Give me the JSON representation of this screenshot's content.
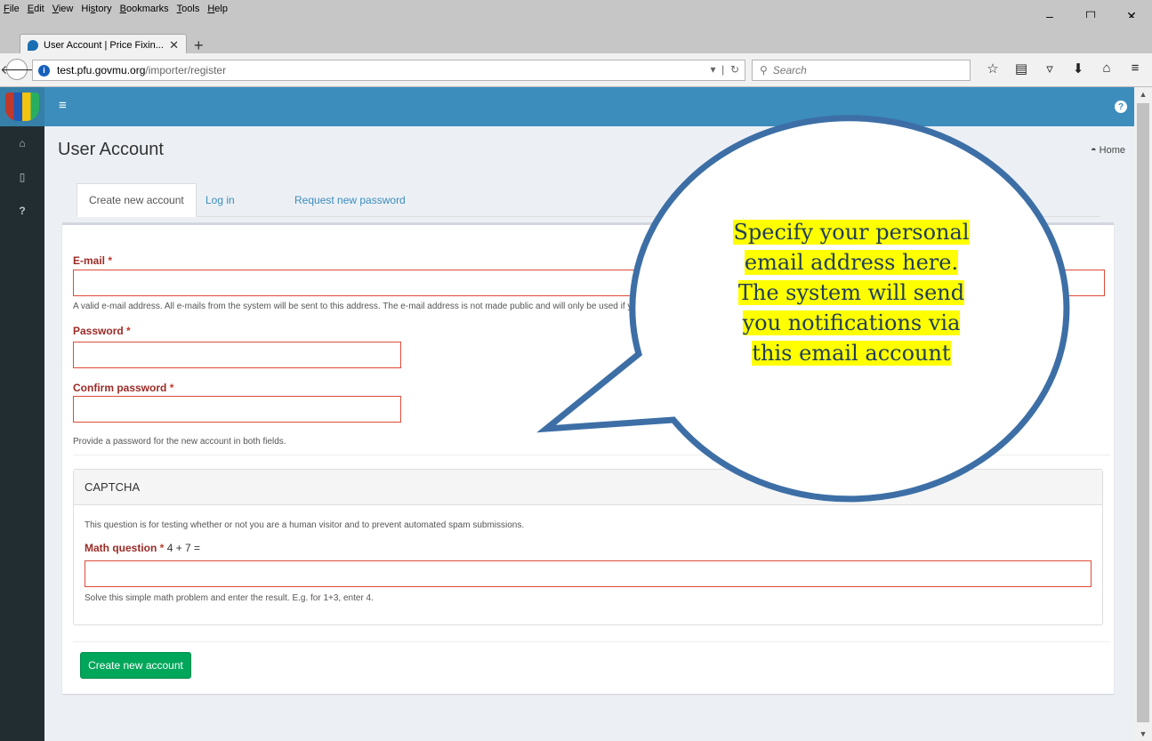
{
  "browser": {
    "menu": [
      "File",
      "Edit",
      "View",
      "History",
      "Bookmarks",
      "Tools",
      "Help"
    ],
    "menu_access_keys": [
      "F",
      "E",
      "V",
      "s",
      "B",
      "T",
      "H"
    ],
    "tab_title": "User Account | Price Fixin...",
    "url_host": "test.pfu.govmu.org",
    "url_path": "/importer/register",
    "search_placeholder": "Search",
    "window_controls": [
      "–",
      "☐",
      "✕"
    ]
  },
  "app": {
    "page_title": "User Account",
    "breadcrumb_home": "Home",
    "tabs": [
      {
        "label": "Create new account",
        "active": true
      },
      {
        "label": "Log in",
        "active": false
      },
      {
        "label": "Request new password",
        "active": false
      }
    ],
    "form": {
      "email_label": "E-mail",
      "email_help": "A valid e-mail address. All e-mails from the system will be sent to this address. The e-mail address is not made public and will only be used if you wish to receive a new password or wish to receive certain news or notifications by e-mail.",
      "password_label": "Password",
      "confirm_label": "Confirm password",
      "password_help": "Provide a password for the new account in both fields.",
      "required_mark": "*"
    },
    "captcha": {
      "title": "CAPTCHA",
      "description": "This question is for testing whether or not you are a human visitor and to prevent automated spam submissions.",
      "question_label": "Math question",
      "question": "4 + 7 =",
      "help": "Solve this simple math problem and enter the result. E.g. for 1+3, enter 4."
    },
    "submit_label": "Create new account"
  },
  "callout": {
    "lines": [
      "Specify your personal",
      "email address here.",
      "The system will send",
      "you notifications via",
      "this email account"
    ],
    "highlight_color": "#ffff00",
    "outline_color": "#3d6fa6"
  },
  "colors": {
    "topbar": "#3c8dbc",
    "sidebar": "#222d32",
    "label_red": "#9b2b26",
    "field_border": "#dd4b39",
    "submit_green": "#00a65a"
  }
}
